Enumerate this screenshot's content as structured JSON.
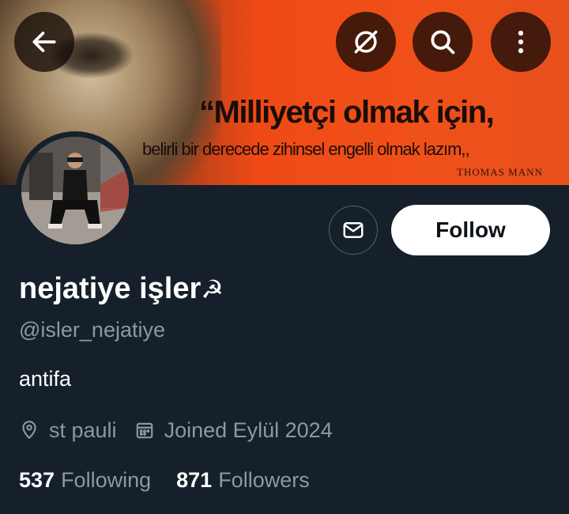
{
  "banner": {
    "quote_line1": "“Milliyetçi olmak için,",
    "quote_line2": "belirli bir derecede zihinsel engelli olmak lazım,,",
    "quote_author": "THOMAS MANN"
  },
  "top_bar": {
    "back_icon": "arrow-left-icon",
    "grok_icon": "grok-icon",
    "search_icon": "search-icon",
    "more_icon": "more-vertical-icon"
  },
  "profile": {
    "display_name": "nejatiye işler",
    "name_emoji": "☭",
    "handle": "@isler_nejatiye",
    "bio": "antifa",
    "location": "st pauli",
    "joined": "Joined Eylül 2024",
    "following_count": "537",
    "following_label": "Following",
    "followers_count": "871",
    "followers_label": "Followers"
  },
  "actions": {
    "message_icon": "envelope-icon",
    "follow_label": "Follow"
  },
  "colors": {
    "background": "#15202b",
    "muted_text": "#8b98a5",
    "banner_orange": "#ef4a16",
    "button_bg": "#ffffff"
  }
}
